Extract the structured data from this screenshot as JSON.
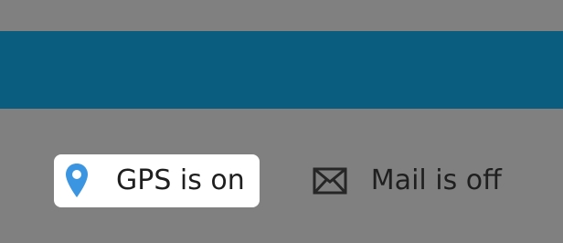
{
  "header": {
    "bar_color": "#0a5d7f"
  },
  "status": {
    "gps": {
      "label": "GPS is on",
      "icon": "map-pin-icon",
      "state": "on",
      "icon_color": "#3b95e0"
    },
    "mail": {
      "label": "Mail is off",
      "icon": "envelope-icon",
      "state": "off",
      "icon_color": "#262626"
    }
  }
}
